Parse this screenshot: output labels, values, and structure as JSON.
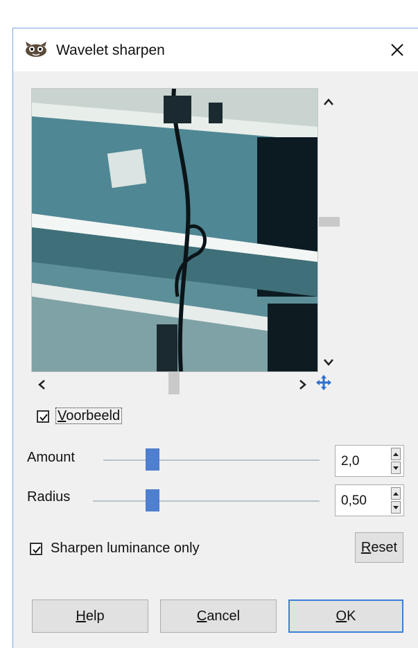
{
  "window": {
    "title": "Wavelet sharpen",
    "app_icon": "gimp-wilber-icon",
    "close_icon": "close-icon"
  },
  "preview": {
    "image_alt": "photo preview",
    "scroll_up_icon": "chevron-up-icon",
    "scroll_down_icon": "chevron-down-icon",
    "scroll_left_icon": "chevron-left-icon",
    "scroll_right_icon": "chevron-right-icon",
    "navigate_icon": "move-arrows-icon"
  },
  "preview_toggle": {
    "label_access_key": "V",
    "label_rest": "oorbeeld",
    "checked": true
  },
  "amount": {
    "label": "Amount",
    "value": "2,0",
    "slider_position": 0.2
  },
  "radius": {
    "label": "Radius",
    "value": "0,50",
    "slider_position": 0.25
  },
  "luminance": {
    "label": "Sharpen luminance only",
    "checked": true
  },
  "buttons": {
    "reset_key": "R",
    "reset_rest": "eset",
    "help_key": "H",
    "help_rest": "elp",
    "cancel_key": "C",
    "cancel_rest": "ancel",
    "ok_key": "O",
    "ok_rest": "K"
  },
  "colors": {
    "accent": "#4f7fd0",
    "dialog_bg": "#f0f0f0",
    "default_button_border": "#3c7fd8"
  }
}
